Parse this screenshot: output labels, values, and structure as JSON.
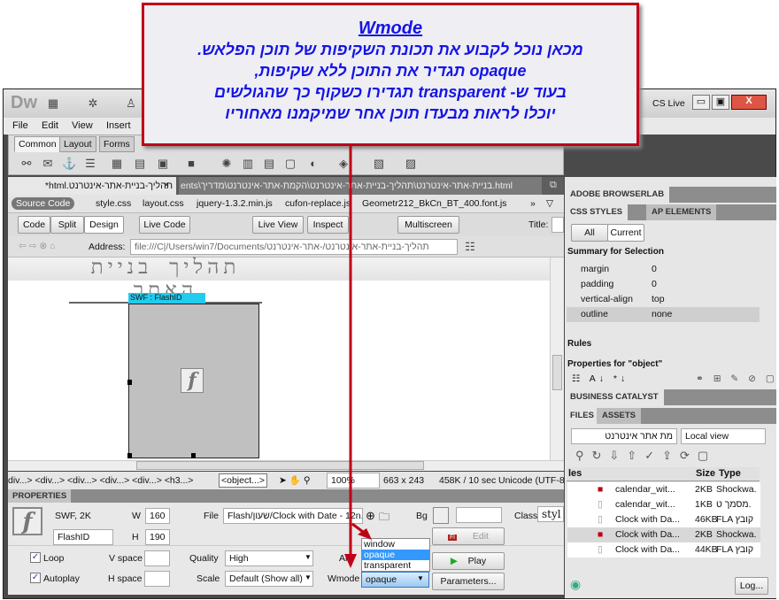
{
  "callout": {
    "title": "Wmode",
    "lines": [
      "מכאן נוכל לקבוע את תכונת השקיפות של תוכן הפלאש.",
      "opaque תגדיר את התוכן ללא שקיפות,",
      "בעוד ש- transparent תגדירו כשקוף כך שהגולשים",
      "יוכלו לראות מבעדו תוכן אחר שמיקמנו מאחוריו"
    ]
  },
  "app": {
    "logo": "Dw",
    "cs_live": "CS Live"
  },
  "menu": [
    "File",
    "Edit",
    "View",
    "Insert"
  ],
  "insert_tabs": [
    "Common",
    "Layout",
    "Forms"
  ],
  "doc_tabs": {
    "active": "תהליך-בניית-אתר-אינטרנט.html*",
    "path": "ents\\בניית-אתר-אינטרנט\\תהליך-בניית-אתר-אינטרנט\\הקמת-אתר-אינטרנט\\מדריך.html"
  },
  "related_files": [
    "Source Code",
    "style.css",
    "layout.css",
    "jquery-1.3.2.min.js",
    "cufon-replace.js",
    "Geometr212_BkCn_BT_400.font.js"
  ],
  "doc_toolbar": {
    "code": "Code",
    "split": "Split",
    "design": "Design",
    "live_code": "Live Code",
    "live_view": "Live View",
    "inspect": "Inspect",
    "multiscreen": "Multiscreen",
    "title_label": "Title:"
  },
  "address": {
    "label": "Address:",
    "value": "file:///C|/Users/win7/Documents/תהליך-בניית-אתר-אינטרנט/-אתר-אינטרנט"
  },
  "design": {
    "heading": "תהליך בניית האתר",
    "swf_label": "SWF : FlashID"
  },
  "status": {
    "tags": "div...> <div...> <div...> <div...> <div...> <h3...>",
    "selected_tag": "<object...>",
    "zoom": "100%",
    "size": "663 x 243",
    "download": "458K / 10 sec",
    "encoding": "Unicode (UTF-8"
  },
  "properties": {
    "header": "PROPERTIES",
    "type": "SWF, 2K",
    "id": "FlashID",
    "w_label": "W",
    "w": "160",
    "h_label": "H",
    "h": "190",
    "file_label": "File",
    "file": "Flash/שעון/Clock with Date - 12n.",
    "bg_label": "Bg",
    "class_label": "Class",
    "class": "styl",
    "edit": "Edit",
    "loop": "Loop",
    "autoplay": "Autoplay",
    "vspace": "V space",
    "hspace": "H space",
    "quality_label": "Quality",
    "quality": "High",
    "scale_label": "Scale",
    "scale": "Default (Show all)",
    "align_label": "Al",
    "wmode_label": "Wmode",
    "wmode": "opaque",
    "wmode_options": [
      "window",
      "opaque",
      "transparent"
    ],
    "play": "Play",
    "parameters": "Parameters..."
  },
  "panels": {
    "browserlab": "ADOBE BROWSERLAB",
    "css_styles": "CSS STYLES",
    "ap_elements": "AP ELEMENTS",
    "all": "All",
    "current": "Current",
    "summary": "Summary for Selection",
    "css_rows": [
      {
        "p": "margin",
        "v": "0"
      },
      {
        "p": "padding",
        "v": "0"
      },
      {
        "p": "vertical-align",
        "v": "top"
      },
      {
        "p": "outline",
        "v": "none"
      }
    ],
    "rules": "Rules",
    "props_for": "Properties for \"object\"",
    "business": "BUSINESS CATALYST",
    "files": "FILES",
    "assets": "ASSETS",
    "site": "מת אתר אינטרנט",
    "view": "Local view",
    "cols": {
      "name": "les",
      "size": "Size",
      "type": "Type"
    },
    "file_rows": [
      {
        "n": "calendar_wit...",
        "s": "2KB",
        "t": "Shockwa.",
        "swf": true
      },
      {
        "n": "calendar_wit...",
        "s": "1KB",
        "t": "מסמך ט.",
        "swf": false
      },
      {
        "n": "Clock with Da...",
        "s": "46KB",
        "t": "FLA קובץ",
        "swf": false
      },
      {
        "n": "Clock with Da...",
        "s": "2KB",
        "t": "Shockwa.",
        "swf": true
      },
      {
        "n": "Clock with Da...",
        "s": "44KB",
        "t": "FLA קובץ",
        "swf": false
      }
    ],
    "log": "Log..."
  },
  "colors": {
    "callout_border": "#c00018",
    "callout_text": "#1414e6",
    "selection": "#3399ff",
    "swf_label": "#22ccee"
  }
}
